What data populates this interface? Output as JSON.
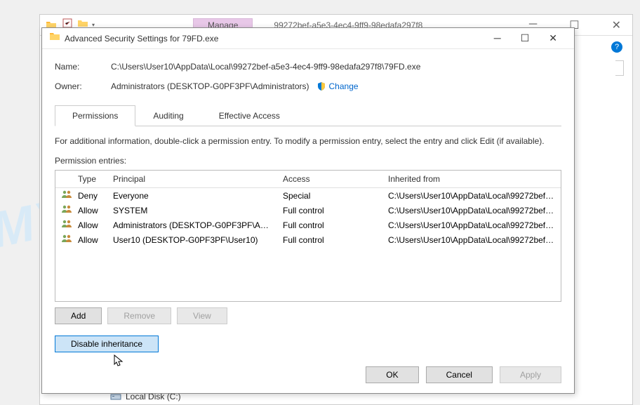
{
  "explorer": {
    "ribbon_tab": "Manage",
    "title": "99272bef-a5e3-4ec4-9ff9-98edafa297f8",
    "local_disk": "Local Disk (C:)"
  },
  "dialog": {
    "title": "Advanced Security Settings for 79FD.exe",
    "fields": {
      "name_label": "Name:",
      "name_value": "C:\\Users\\User10\\AppData\\Local\\99272bef-a5e3-4ec4-9ff9-98edafa297f8\\79FD.exe",
      "owner_label": "Owner:",
      "owner_value": "Administrators (DESKTOP-G0PF3PF\\Administrators)",
      "change_link": "Change"
    },
    "tabs": {
      "permissions": "Permissions",
      "auditing": "Auditing",
      "effective": "Effective Access"
    },
    "info_text": "For additional information, double-click a permission entry. To modify a permission entry, select the entry and click Edit (if available).",
    "entries_label": "Permission entries:",
    "headers": {
      "type": "Type",
      "principal": "Principal",
      "access": "Access",
      "inherited": "Inherited from"
    },
    "entries": [
      {
        "type": "Deny",
        "principal": "Everyone",
        "access": "Special",
        "inherited": "C:\\Users\\User10\\AppData\\Local\\99272bef-a..."
      },
      {
        "type": "Allow",
        "principal": "SYSTEM",
        "access": "Full control",
        "inherited": "C:\\Users\\User10\\AppData\\Local\\99272bef-a..."
      },
      {
        "type": "Allow",
        "principal": "Administrators (DESKTOP-G0PF3PF\\Admini...",
        "access": "Full control",
        "inherited": "C:\\Users\\User10\\AppData\\Local\\99272bef-a..."
      },
      {
        "type": "Allow",
        "principal": "User10 (DESKTOP-G0PF3PF\\User10)",
        "access": "Full control",
        "inherited": "C:\\Users\\User10\\AppData\\Local\\99272bef-a..."
      }
    ],
    "buttons": {
      "add": "Add",
      "remove": "Remove",
      "view": "View",
      "disable_inheritance": "Disable inheritance",
      "ok": "OK",
      "cancel": "Cancel",
      "apply": "Apply"
    }
  },
  "watermark": "MYANTISPYWARE.COM"
}
